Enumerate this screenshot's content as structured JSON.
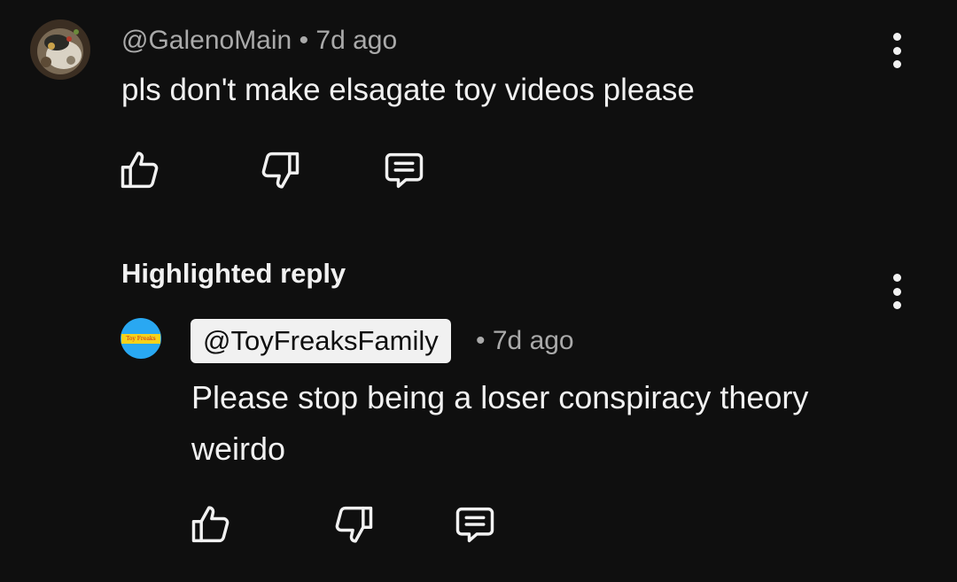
{
  "comment": {
    "handle": "@GalenoMain",
    "separator": "•",
    "time": "7d ago",
    "text": "pls don't make elsagate toy videos please",
    "avatar_icon": "food-photo-avatar",
    "actions": {
      "like_icon": "thumbs-up-icon",
      "dislike_icon": "thumbs-down-icon",
      "reply_icon": "reply-comment-icon"
    },
    "menu_icon": "more-vert-icon"
  },
  "highlighted_reply": {
    "label": "Highlighted reply",
    "menu_icon": "more-vert-icon",
    "author": "@ToyFreaksFamily",
    "author_badge_color": "#f1f1f1",
    "avatar_color": "#29a8f2",
    "avatar_text": "Toy Freaks",
    "separator": "•",
    "time": "7d ago",
    "text": "Please stop being a loser conspiracy theory weirdo",
    "actions": {
      "like_icon": "thumbs-up-icon",
      "dislike_icon": "thumbs-down-icon",
      "reply_icon": "reply-comment-icon"
    }
  },
  "theme": {
    "background": "#0f0f0f",
    "primary_text": "#f1f1f1",
    "secondary_text": "#aaaaaa"
  }
}
